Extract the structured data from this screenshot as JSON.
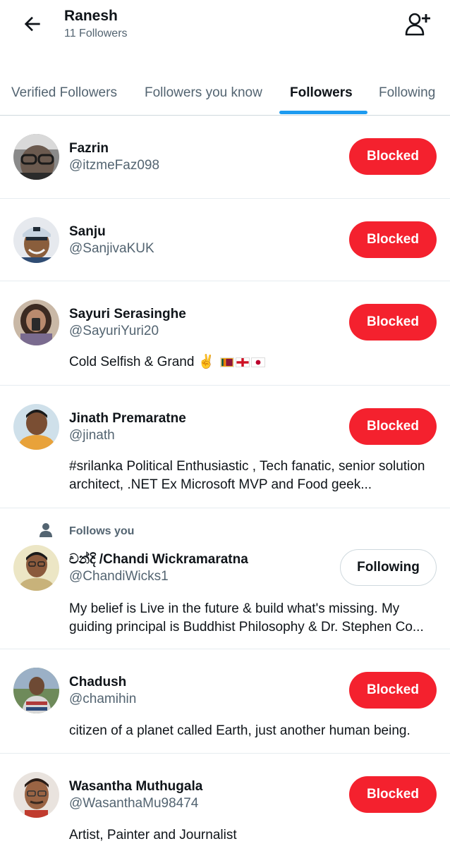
{
  "header": {
    "title": "Ranesh",
    "subtitle": "11 Followers",
    "back_icon": "arrow-left-icon",
    "add_user_icon": "person-add-icon"
  },
  "tabs": [
    {
      "label": "Verified Followers",
      "active": false
    },
    {
      "label": "Followers you know",
      "active": false
    },
    {
      "label": "Followers",
      "active": true
    },
    {
      "label": "Following",
      "active": false
    }
  ],
  "colors": {
    "accent": "#1d9bf0",
    "blocked": "#f4212e",
    "text_secondary": "#536471"
  },
  "users": [
    {
      "name": "Fazrin",
      "handle": "@itzmeFaz098",
      "bio": "",
      "button": "Blocked",
      "follows_you": false
    },
    {
      "name": "Sanju",
      "handle": "@SanjivaKUK",
      "bio": "",
      "button": "Blocked",
      "follows_you": false
    },
    {
      "name": "Sayuri Serasinghe",
      "handle": "@SayuriYuri20",
      "bio": "Cold Selfish & Grand ✌️",
      "bio_flags": [
        "sri-lanka-flag",
        "england-flag",
        "japan-flag"
      ],
      "button": "Blocked",
      "follows_you": false
    },
    {
      "name": "Jinath Premaratne",
      "handle": "@jinath",
      "bio": "#srilanka Political Enthusiastic , Tech fanatic, senior solution architect, .NET Ex Microsoft MVP and Food geek...",
      "button": "Blocked",
      "follows_you": false
    },
    {
      "name": "චන්දි /Chandi Wickramaratna",
      "handle": "@ChandiWicks1",
      "bio": "My belief is Live in the future & build what's missing. My guiding principal is Buddhist Philosophy & Dr. Stephen Co...",
      "button": "Following",
      "follows_you": true,
      "follows_you_label": "Follows you"
    },
    {
      "name": "Chadush",
      "handle": "@chamihin",
      "bio": "citizen of a planet called Earth, just another human being.",
      "button": "Blocked",
      "follows_you": false
    },
    {
      "name": "Wasantha Muthugala",
      "handle": "@WasanthaMu98474",
      "bio": "Artist, Painter and Journalist",
      "button": "Blocked",
      "follows_you": false
    }
  ]
}
